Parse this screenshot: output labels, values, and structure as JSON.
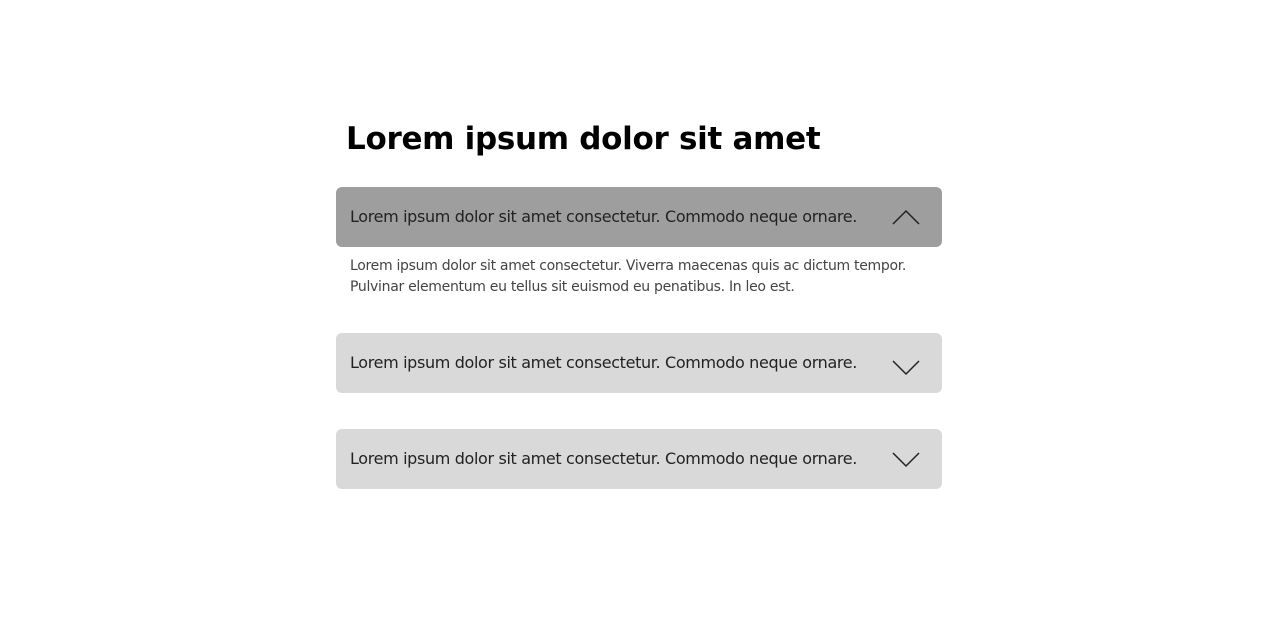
{
  "heading": "Lorem ipsum dolor sit amet",
  "accordion": {
    "items": [
      {
        "question": "Lorem ipsum dolor sit amet consectetur. Commodo neque ornare.",
        "expanded": true,
        "answer_line_1": "Lorem ipsum dolor sit amet consectetur. Viverra maecenas quis ac dictum tempor.",
        "answer_line_2": "Pulvinar elementum eu tellus sit euismod eu penatibus. In leo est.",
        "icon": "chevron-up-icon"
      },
      {
        "question": "Lorem ipsum dolor sit amet consectetur. Commodo neque ornare.",
        "expanded": false,
        "icon": "chevron-down-icon"
      },
      {
        "question": "Lorem ipsum dolor sit amet consectetur. Commodo neque ornare.",
        "expanded": false,
        "icon": "chevron-down-icon"
      }
    ]
  },
  "colors": {
    "open_header": "#9e9e9e",
    "closed_header": "#d9d9d9",
    "background": "#ffffff"
  }
}
